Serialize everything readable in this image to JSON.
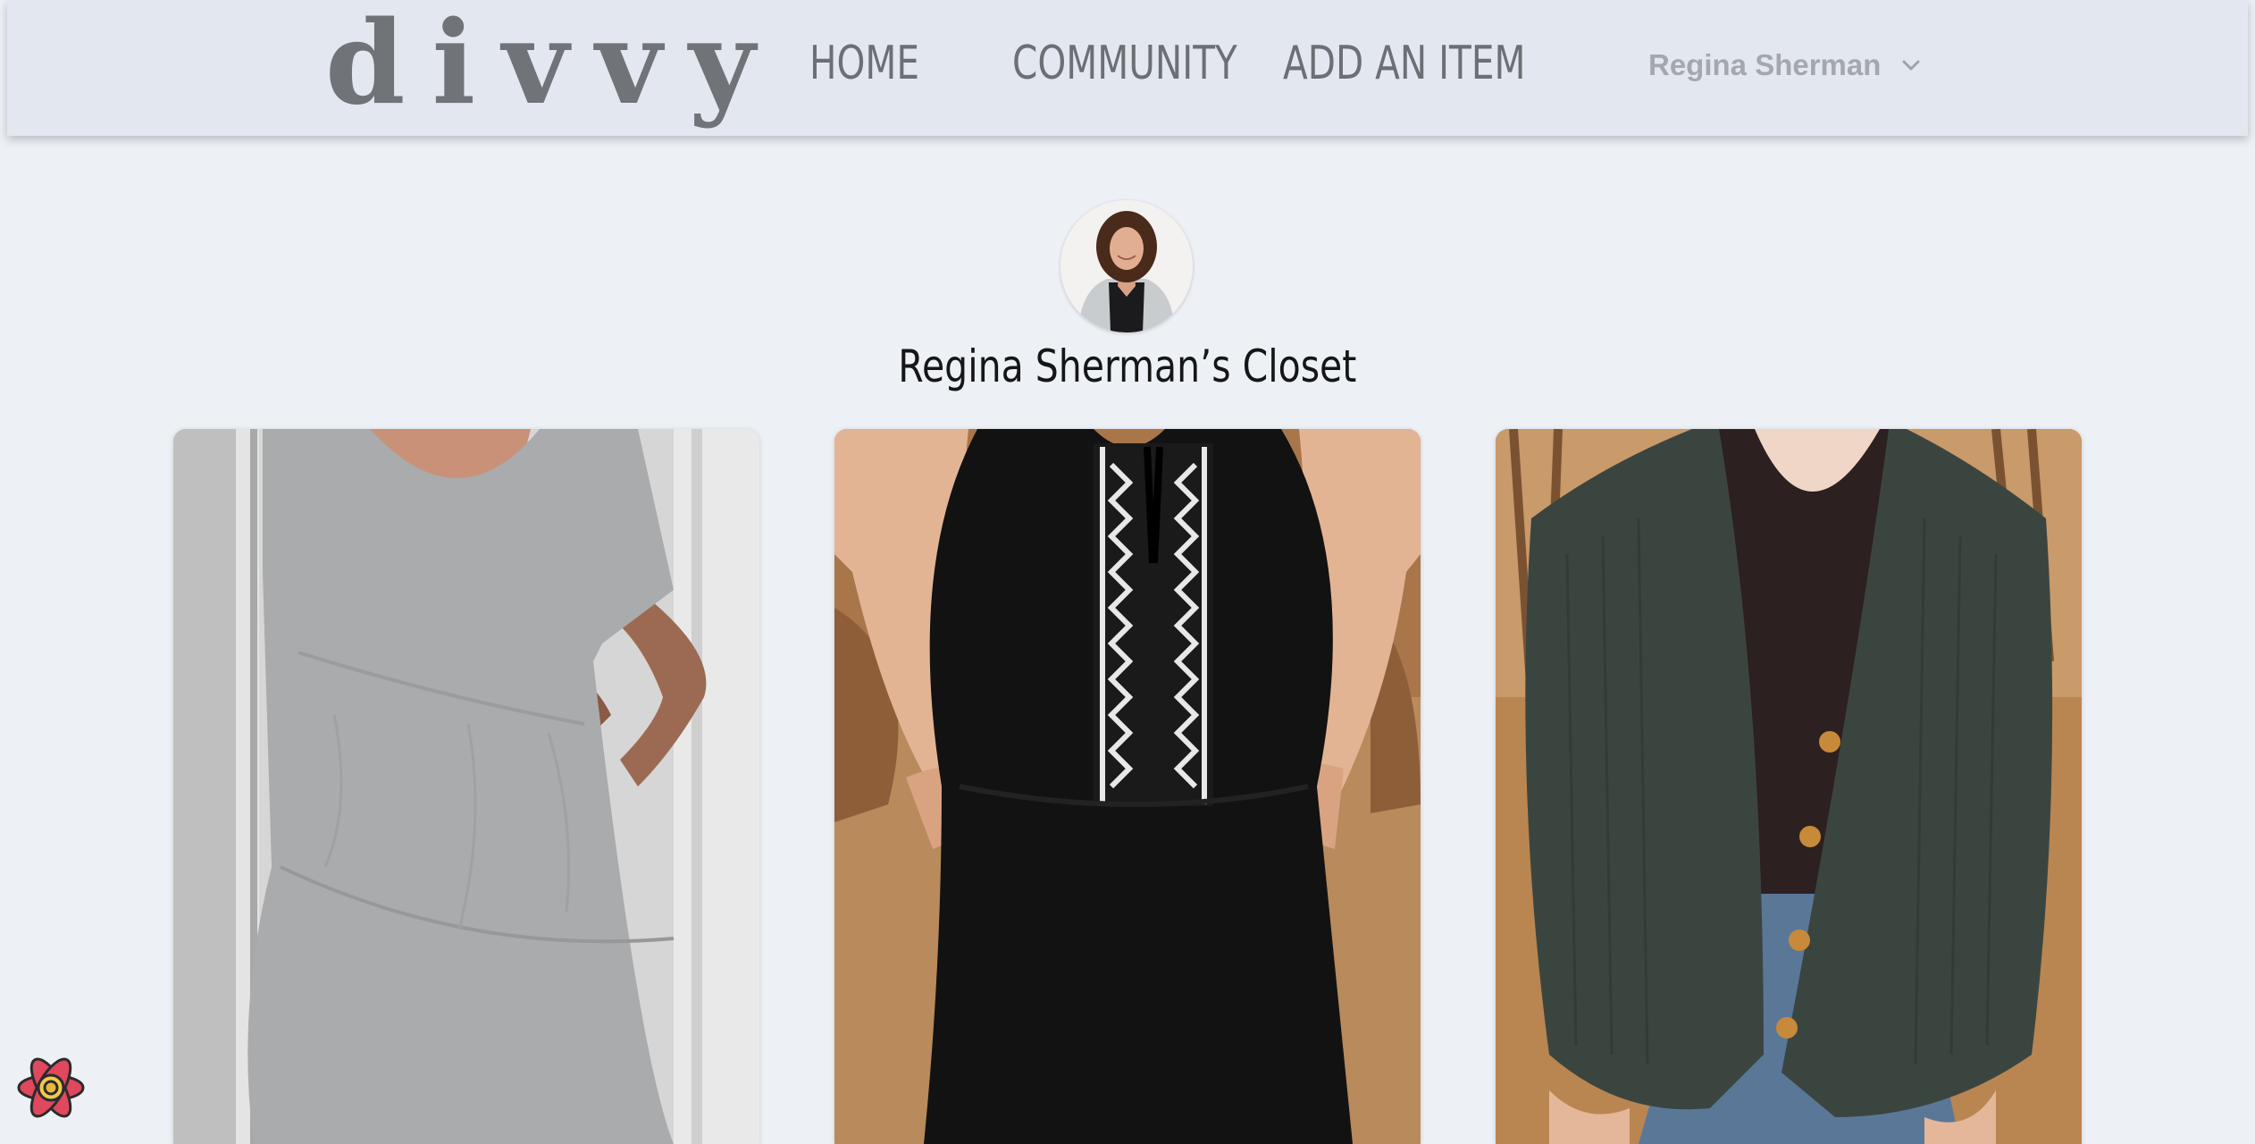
{
  "nav": {
    "logo": "divvy",
    "links": [
      "HOME",
      "COMMUNITY",
      "ADD AN ITEM"
    ],
    "user_name": "Regina Sherman"
  },
  "closet": {
    "title": "Regina Sherman’s Closet"
  },
  "items": [
    {
      "image": "gray-tiered-tshirt-dress"
    },
    {
      "image": "black-embroidered-jumpsuit"
    },
    {
      "image": "olive-knit-cardigan"
    }
  ],
  "icons": {
    "user_menu": "chevron-down-icon",
    "devtools": "react-devtools-icon"
  },
  "colors": {
    "navbar_bg": "#e3e8f0",
    "page_bg": "#edf1f6",
    "logo": "#707377",
    "nav_text": "#6c6f73",
    "user_text": "#a4a8ad"
  }
}
